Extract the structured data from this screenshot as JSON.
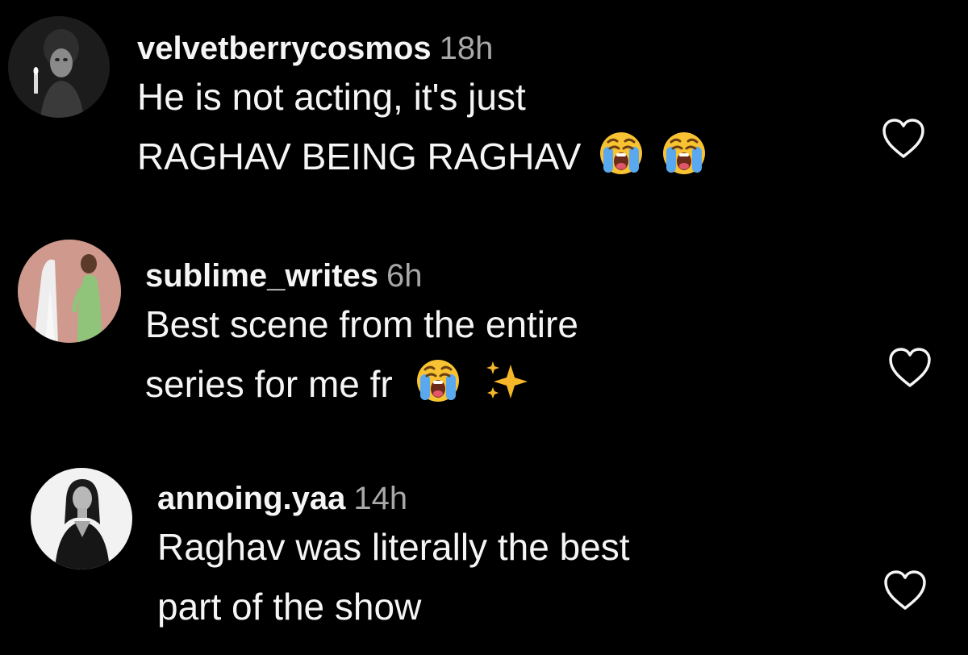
{
  "comments": [
    {
      "username": "velvetberrycosmos",
      "time": "18h",
      "lines": [
        "He is not acting, it's just",
        "RAGHAV BEING RAGHAV"
      ],
      "emojis": [
        "loudly-crying-face",
        "loudly-crying-face"
      ]
    },
    {
      "username": "sublime_writes",
      "time": "6h",
      "lines": [
        "Best scene from the entire",
        "series for me fr"
      ],
      "emojis": [
        "loudly-crying-face",
        "sparkles"
      ]
    },
    {
      "username": "annoing.yaa",
      "time": "14h",
      "lines": [
        "Raghav was literally the best",
        "part of the show"
      ],
      "emojis": []
    }
  ],
  "icons": {
    "like": "heart-outline-icon"
  },
  "colors": {
    "background": "#000000",
    "primary_text": "#f5f5f5",
    "secondary_text": "#a8a8a8"
  }
}
